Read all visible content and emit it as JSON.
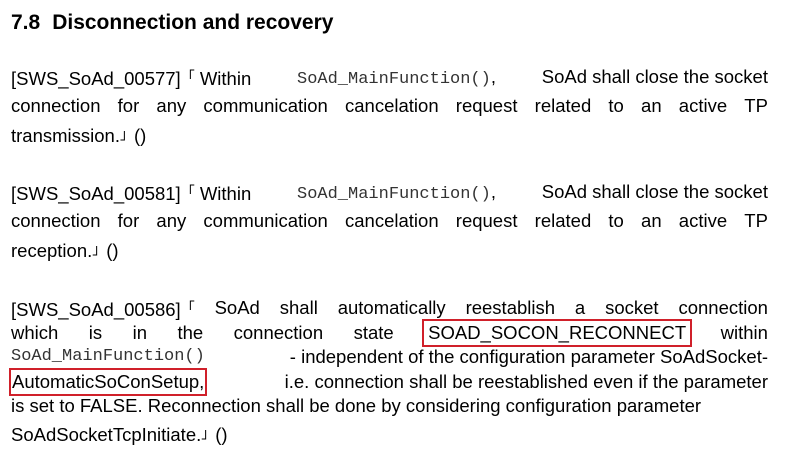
{
  "heading": {
    "number": "7.8",
    "title": "Disconnection and recovery"
  },
  "open_mark": "「",
  "close_mark": "」",
  "trace": "()",
  "mainfunc": "SoAd_MainFunction()",
  "req1": {
    "id": "[SWS_SoAd_00577]",
    "l1": [
      "Within",
      "SoAd shall close the socket"
    ],
    "l2": [
      "connection",
      "for",
      "any",
      "communication",
      "cancelation",
      "request",
      "related",
      "to",
      "an",
      "active",
      "TP"
    ],
    "l3": "transmission."
  },
  "req2": {
    "id": "[SWS_SoAd_00581]",
    "l1": [
      "Within",
      "SoAd shall close the socket"
    ],
    "l2": [
      "connection",
      "for",
      "any",
      "communication",
      "cancelation",
      "request",
      "related",
      "to",
      "an",
      "active",
      "TP"
    ],
    "l3": "reception."
  },
  "req3": {
    "id": "[SWS_SoAd_00586]",
    "l1": [
      "SoAd",
      "shall",
      "automatically",
      "reestablish",
      "a",
      "socket",
      "connection"
    ],
    "l2": [
      "which",
      "is",
      "in",
      "the",
      "connection",
      "state"
    ],
    "state": "SOAD_SOCON_RECONNECT",
    "within": "within",
    "l3_rest": "- independent of the configuration parameter SoAdSocket-",
    "param": "AutomaticSoConSetup,",
    "l4_rest": "i.e. connection shall be reestablished even if the parameter",
    "l5": "is set to FALSE. Reconnection shall be done by considering configuration parameter",
    "l6": "SoAdSocketTcpInitiate."
  }
}
